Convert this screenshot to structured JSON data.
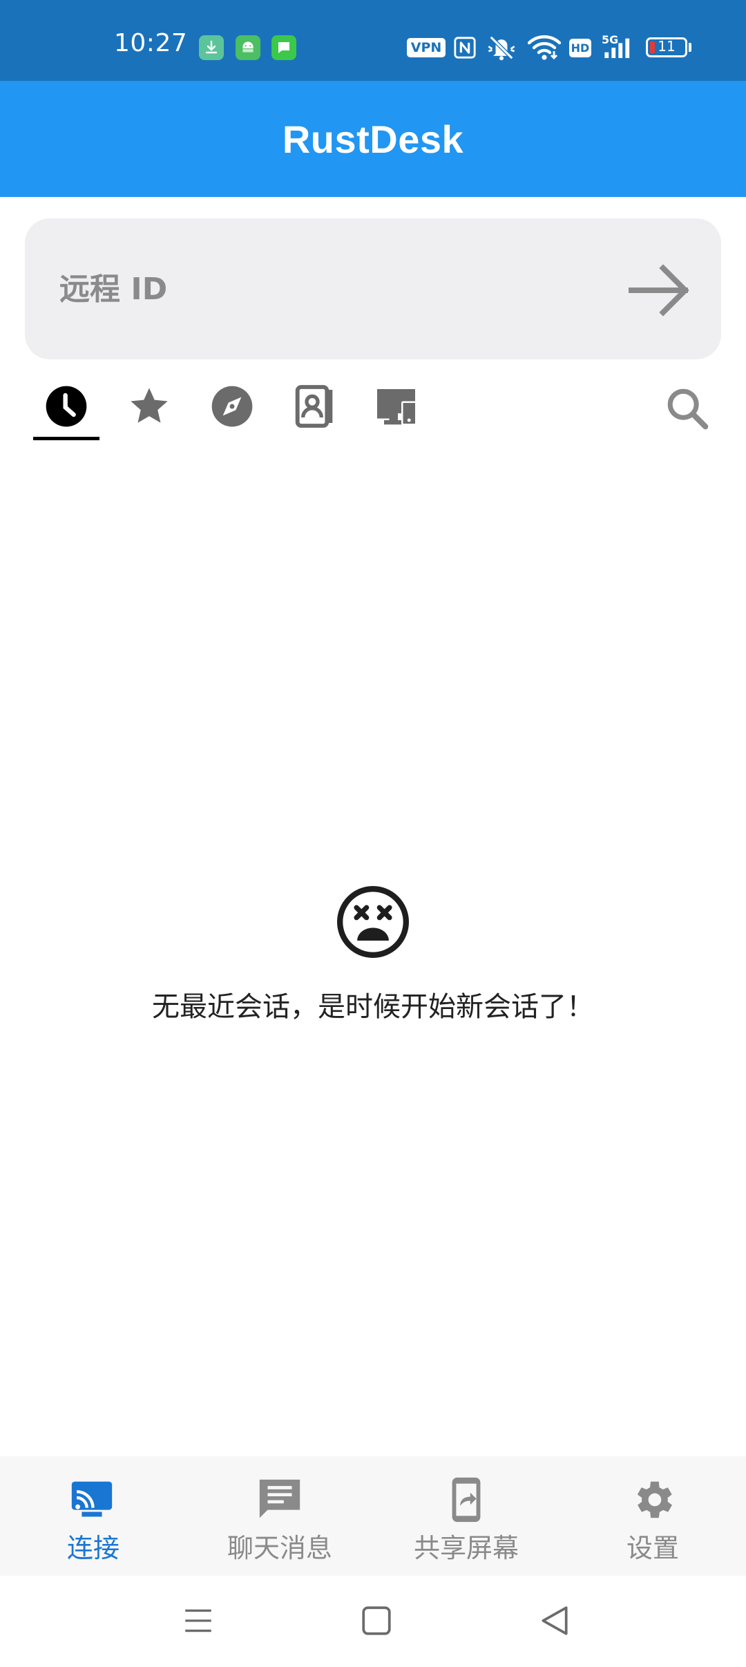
{
  "status_bar": {
    "time": "10:27",
    "vpn": "VPN",
    "hd": "HD",
    "network": "5G",
    "battery": "11"
  },
  "app_bar": {
    "title": "RustDesk"
  },
  "remote_id": {
    "placeholder": "远程 ID",
    "value": ""
  },
  "tabs": [
    {
      "icon": "history-icon",
      "active": true
    },
    {
      "icon": "star-icon",
      "active": false
    },
    {
      "icon": "compass-icon",
      "active": false
    },
    {
      "icon": "address-book-icon",
      "active": false
    },
    {
      "icon": "devices-icon",
      "active": false
    }
  ],
  "empty_state": {
    "icon": "dizzy-face-icon",
    "message": "无最近会话，是时候开始新会话了！"
  },
  "bottom_nav": {
    "items": [
      {
        "label": "连接",
        "icon": "cast-icon",
        "active": true
      },
      {
        "label": "聊天消息",
        "icon": "chat-icon",
        "active": false
      },
      {
        "label": "共享屏幕",
        "icon": "share-screen-icon",
        "active": false
      },
      {
        "label": "设置",
        "icon": "gear-icon",
        "active": false
      }
    ]
  },
  "colors": {
    "status_bar": "#1a72bb",
    "app_bar": "#2196f3",
    "active_nav": "#1976d2",
    "inactive": "#8a8a8a"
  }
}
